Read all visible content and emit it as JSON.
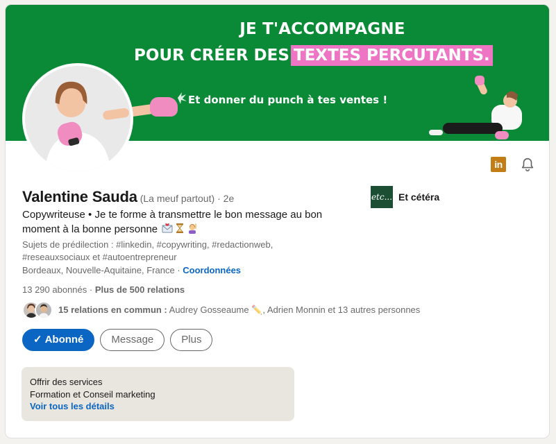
{
  "banner": {
    "line1": "JE T'ACCOMPAGNE",
    "line2_prefix": "POUR CRÉER DES",
    "line2_highlight": "TEXTES PERCUTANTS.",
    "subline": "Et donner du punch à tes ventes !",
    "bg_color": "#0a8a36",
    "highlight_color": "#ee74c4"
  },
  "profile": {
    "name": "Valentine Sauda",
    "pronoun": "(La meuf partout)",
    "degree": "· 2e",
    "headline": "Copywriteuse • Je te forme à transmettre le bon message au bon moment à la bonne personne",
    "headline_emojis": [
      "envelope-icon",
      "hourglass-icon",
      "raising-hand-icon"
    ],
    "topics": "Sujets de prédilection : #linkedin, #copywriting, #redactionweb, #reseauxsociaux et #autoentrepreneur",
    "location": "Bordeaux, Nouvelle-Aquitaine, France",
    "location_sep": " · ",
    "contact_link": "Coordonnées",
    "followers": "13 290 abonnés",
    "stats_sep": " · ",
    "connections": "Plus de 500 relations",
    "mutual_bold": "15 relations en commun :",
    "mutual_rest": " Audrey Gosseaume ✏️, Adrien Monnin et 13 autres personnes"
  },
  "company": {
    "logo_text": "etc...",
    "name": "Et cétéra"
  },
  "top_icons": {
    "linkedin_badge": "in",
    "bell": "bell-icon"
  },
  "actions": {
    "following_check": "✓",
    "following_label": "Abonné",
    "message_label": "Message",
    "more_label": "Plus",
    "accent_color": "#0a66c2"
  },
  "services": {
    "title": "Offrir des services",
    "description": "Formation et Conseil marketing",
    "link": "Voir tous les détails"
  }
}
